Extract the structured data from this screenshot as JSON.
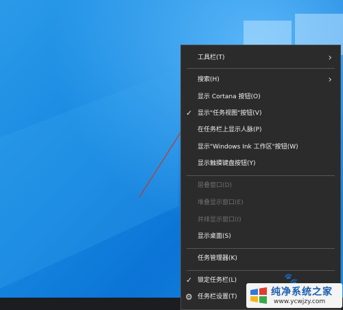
{
  "menu": {
    "items": [
      {
        "label": "工具栏(T)",
        "submenu": true,
        "disabled": false,
        "check": false
      },
      {
        "label": "搜索(H)",
        "submenu": true,
        "disabled": false,
        "check": false
      },
      {
        "label": "显示 Cortana 按钮(O)",
        "submenu": false,
        "disabled": false,
        "check": false
      },
      {
        "label": "显示\"任务视图\"按钮(V)",
        "submenu": false,
        "disabled": false,
        "check": true
      },
      {
        "label": "在任务栏上显示人脉(P)",
        "submenu": false,
        "disabled": false,
        "check": false
      },
      {
        "label": "显示\"Windows Ink 工作区\"按钮(W)",
        "submenu": false,
        "disabled": false,
        "check": false
      },
      {
        "label": "显示触摸键盘按钮(Y)",
        "submenu": false,
        "disabled": false,
        "check": false
      },
      {
        "label": "层叠窗口(D)",
        "submenu": false,
        "disabled": true,
        "check": false
      },
      {
        "label": "堆叠显示窗口(E)",
        "submenu": false,
        "disabled": true,
        "check": false
      },
      {
        "label": "并排显示窗口(I)",
        "submenu": false,
        "disabled": true,
        "check": false
      },
      {
        "label": "显示桌面(S)",
        "submenu": false,
        "disabled": false,
        "check": false
      },
      {
        "label": "任务管理器(K)",
        "submenu": false,
        "disabled": false,
        "check": false
      },
      {
        "label": "锁定任务栏(L)",
        "submenu": false,
        "disabled": false,
        "check": true
      },
      {
        "label": "任务栏设置(T)",
        "submenu": false,
        "disabled": false,
        "check": false,
        "icon": "gear-icon"
      }
    ]
  },
  "watermark": {
    "title": "纯净系统之家",
    "url": "www.ycwjzy.com"
  },
  "colors": {
    "menu_bg": "#2b2b2b",
    "menu_text": "#f2f2f2",
    "disabled_text": "#707070",
    "arrow": "#c0392b",
    "desktop": "#1789e1"
  }
}
